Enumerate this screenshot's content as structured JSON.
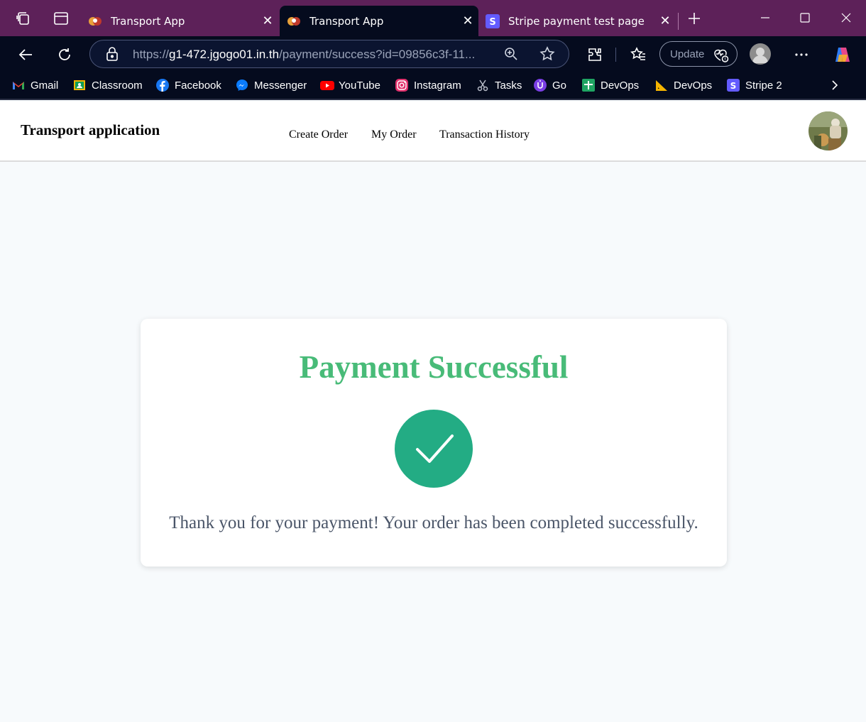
{
  "browser": {
    "tabs": [
      {
        "title": "Transport App",
        "favicon": "transport-app-favicon",
        "active": false
      },
      {
        "title": "Transport App",
        "favicon": "transport-app-favicon",
        "active": true
      },
      {
        "title": "Stripe payment test page",
        "favicon": "stripe-favicon",
        "active": false
      }
    ],
    "url": {
      "scheme": "https://",
      "host": "g1-472.jgogo01.in.th",
      "path": "/payment/success?id=09856c3f-11..."
    },
    "update_label": "Update",
    "bookmarks": [
      {
        "label": "Gmail",
        "icon": "gmail-icon"
      },
      {
        "label": "Classroom",
        "icon": "classroom-icon"
      },
      {
        "label": "Facebook",
        "icon": "facebook-icon"
      },
      {
        "label": "Messenger",
        "icon": "messenger-icon"
      },
      {
        "label": "YouTube",
        "icon": "youtube-icon"
      },
      {
        "label": "Instagram",
        "icon": "instagram-icon"
      },
      {
        "label": "Tasks",
        "icon": "tasks-icon"
      },
      {
        "label": "Go",
        "icon": "go-icon"
      },
      {
        "label": "DevOps",
        "icon": "devops-green-icon"
      },
      {
        "label": "DevOps",
        "icon": "devops-ruler-icon"
      },
      {
        "label": "Stripe 2",
        "icon": "stripe-icon"
      }
    ]
  },
  "site": {
    "brand": "Transport application",
    "nav": [
      "Create Order",
      "My Order",
      "Transaction History"
    ]
  },
  "card": {
    "title": "Payment Successful",
    "message": "Thank you for your payment! Your order has been completed successfully."
  },
  "colors": {
    "title_green": "#48bb78",
    "check_circle": "#23ac84",
    "message_gray": "#4a5568",
    "page_background": "#f7fafc",
    "tabbar": "#5d2159",
    "toolbar": "#050b1e"
  }
}
